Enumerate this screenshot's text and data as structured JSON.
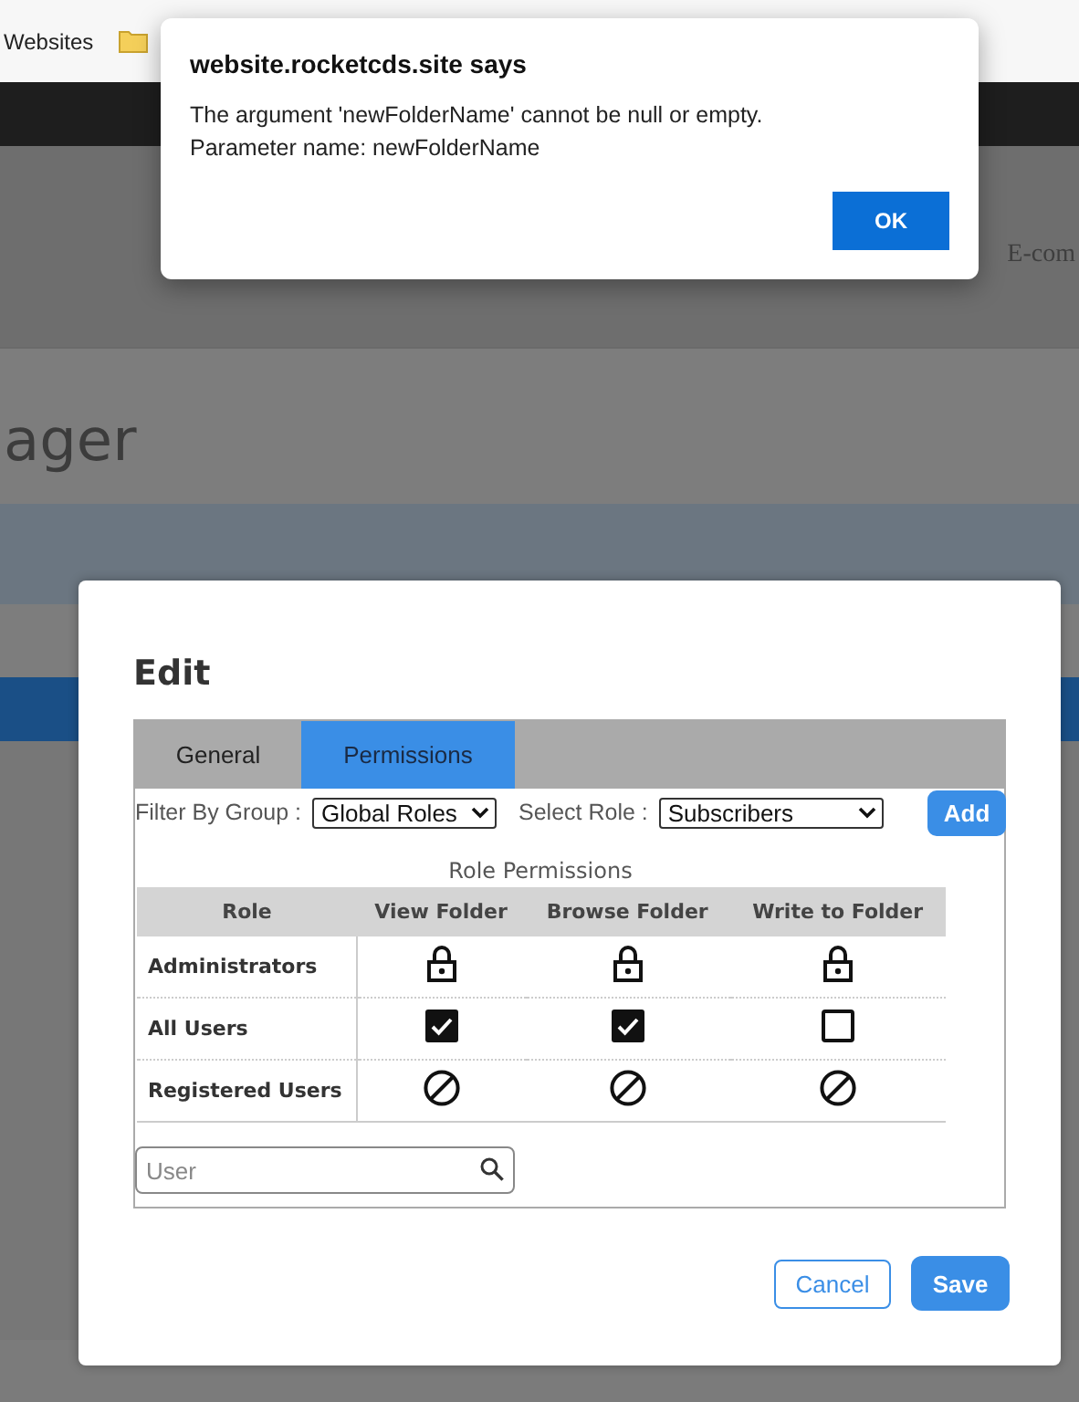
{
  "browser": {
    "bookmark": "Websites"
  },
  "background_page": {
    "nav_link": "E-com",
    "heading": "ager"
  },
  "alert": {
    "title": "website.rocketcds.site says",
    "message_lines": [
      "The argument 'newFolderName' cannot be null or empty.",
      "Parameter name: newFolderName"
    ],
    "button": "OK"
  },
  "dialog": {
    "title": "Edit",
    "tabs": [
      {
        "label": "General",
        "selected": false
      },
      {
        "label": "Permissions",
        "selected": true
      }
    ],
    "filter": {
      "group_label": "Filter By Group :",
      "group_value": "Global Roles",
      "role_label": "Select Role :",
      "role_value": "Subscribers",
      "add_button": "Add"
    },
    "table": {
      "caption": "Role Permissions",
      "columns": [
        "Role",
        "View Folder",
        "Browse Folder",
        "Write to Folder"
      ],
      "rows": [
        {
          "role": "Administrators",
          "cells": [
            {
              "kind": "locked"
            },
            {
              "kind": "locked"
            },
            {
              "kind": "locked"
            }
          ]
        },
        {
          "role": "All Users",
          "cells": [
            {
              "kind": "checkbox",
              "checked": true
            },
            {
              "kind": "checkbox",
              "checked": true
            },
            {
              "kind": "checkbox",
              "checked": false
            }
          ]
        },
        {
          "role": "Registered Users",
          "cells": [
            {
              "kind": "denied"
            },
            {
              "kind": "denied"
            },
            {
              "kind": "denied"
            }
          ]
        }
      ]
    },
    "user_search": {
      "placeholder": "User"
    },
    "buttons": {
      "cancel": "Cancel",
      "save": "Save"
    }
  }
}
